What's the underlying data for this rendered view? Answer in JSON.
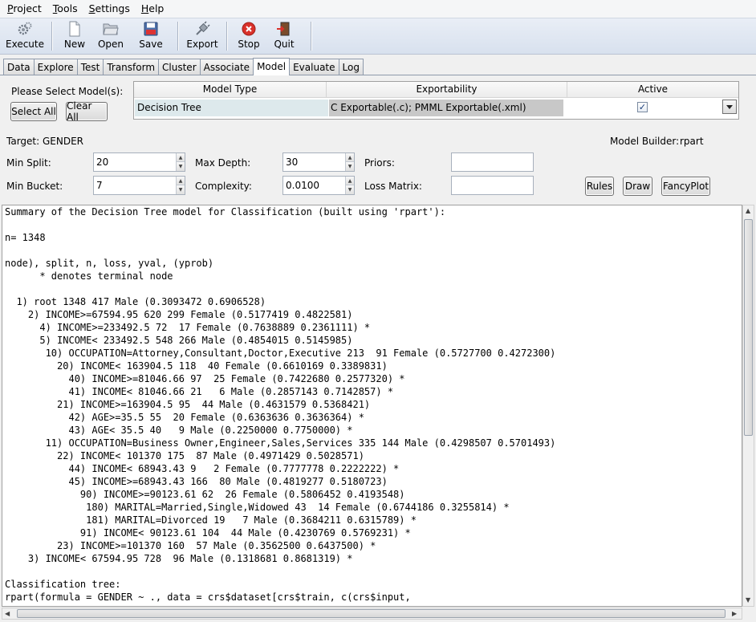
{
  "menu": {
    "items": [
      {
        "label": "Project",
        "accel": "P",
        "rest": "roject"
      },
      {
        "label": "Tools",
        "accel": "T",
        "rest": "ools"
      },
      {
        "label": "Settings",
        "accel": "S",
        "rest": "ettings"
      },
      {
        "label": "Help",
        "accel": "H",
        "rest": "elp"
      }
    ]
  },
  "toolbar": {
    "execute": "Execute",
    "new": "New",
    "open": "Open",
    "save": "Save",
    "export": "Export",
    "stop": "Stop",
    "quit": "Quit"
  },
  "tabs": [
    "Data",
    "Explore",
    "Test",
    "Transform",
    "Cluster",
    "Associate",
    "Model",
    "Evaluate",
    "Log"
  ],
  "active_tab": "Model",
  "model_select": {
    "prompt": "Please Select Model(s):",
    "select_all": "Select All",
    "clear_all": "Clear All",
    "columns": {
      "type": "Model Type",
      "exportability": "Exportability",
      "active": "Active"
    },
    "row": {
      "type": "Decision Tree",
      "exportability": "C Exportable(.c); PMML Exportable(.xml)",
      "active": true
    }
  },
  "target_label": "Target: GENDER",
  "model_builder": {
    "label": "Model Builder:",
    "value": "rpart"
  },
  "params": {
    "min_split": {
      "label": "Min Split:",
      "value": "20"
    },
    "min_bucket": {
      "label": "Min Bucket:",
      "value": "7"
    },
    "max_depth": {
      "label": "Max Depth:",
      "value": "30"
    },
    "complexity": {
      "label": "Complexity:",
      "value": "0.0100"
    },
    "priors": {
      "label": "Priors:",
      "value": ""
    },
    "loss_matrix": {
      "label": "Loss Matrix:",
      "value": ""
    }
  },
  "actions": {
    "rules": "Rules",
    "draw": "Draw",
    "fancyplot": "FancyPlot"
  },
  "output_lines": [
    "Summary of the Decision Tree model for Classification (built using 'rpart'):",
    "",
    "n= 1348",
    "",
    "node), split, n, loss, yval, (yprob)",
    "      * denotes terminal node",
    "",
    "  1) root 1348 417 Male (0.3093472 0.6906528)",
    "    2) INCOME>=67594.95 620 299 Female (0.5177419 0.4822581)",
    "      4) INCOME>=233492.5 72  17 Female (0.7638889 0.2361111) *",
    "      5) INCOME< 233492.5 548 266 Male (0.4854015 0.5145985)",
    "       10) OCCUPATION=Attorney,Consultant,Doctor,Executive 213  91 Female (0.5727700 0.4272300)",
    "         20) INCOME< 163904.5 118  40 Female (0.6610169 0.3389831)",
    "           40) INCOME>=81046.66 97  25 Female (0.7422680 0.2577320) *",
    "           41) INCOME< 81046.66 21   6 Male (0.2857143 0.7142857) *",
    "         21) INCOME>=163904.5 95  44 Male (0.4631579 0.5368421)",
    "           42) AGE>=35.5 55  20 Female (0.6363636 0.3636364) *",
    "           43) AGE< 35.5 40   9 Male (0.2250000 0.7750000) *",
    "       11) OCCUPATION=Business Owner,Engineer,Sales,Services 335 144 Male (0.4298507 0.5701493)",
    "         22) INCOME< 101370 175  87 Male (0.4971429 0.5028571)",
    "           44) INCOME< 68943.43 9   2 Female (0.7777778 0.2222222) *",
    "           45) INCOME>=68943.43 166  80 Male (0.4819277 0.5180723)",
    "             90) INCOME>=90123.61 62  26 Female (0.5806452 0.4193548)",
    "              180) MARITAL=Married,Single,Widowed 43  14 Female (0.6744186 0.3255814) *",
    "              181) MARITAL=Divorced 19   7 Male (0.3684211 0.6315789) *",
    "             91) INCOME< 90123.61 104  44 Male (0.4230769 0.5769231) *",
    "         23) INCOME>=101370 160  57 Male (0.3562500 0.6437500) *",
    "    3) INCOME< 67594.95 728  96 Male (0.1318681 0.8681319) *",
    "",
    "Classification tree:",
    "rpart(formula = GENDER ~ ., data = crs$dataset[crs$train, c(crs$input,"
  ],
  "colors": {
    "grid_selected": "#dde9ec",
    "grid_grey": "#c8c8c8",
    "toolbar_top": "#e9eef6",
    "stop_red": "#d9312a"
  },
  "icons": [
    "execute-gears-icon",
    "new-document-icon",
    "open-folder-icon",
    "save-disk-icon",
    "export-plug-icon",
    "stop-icon",
    "quit-door-icon"
  ]
}
